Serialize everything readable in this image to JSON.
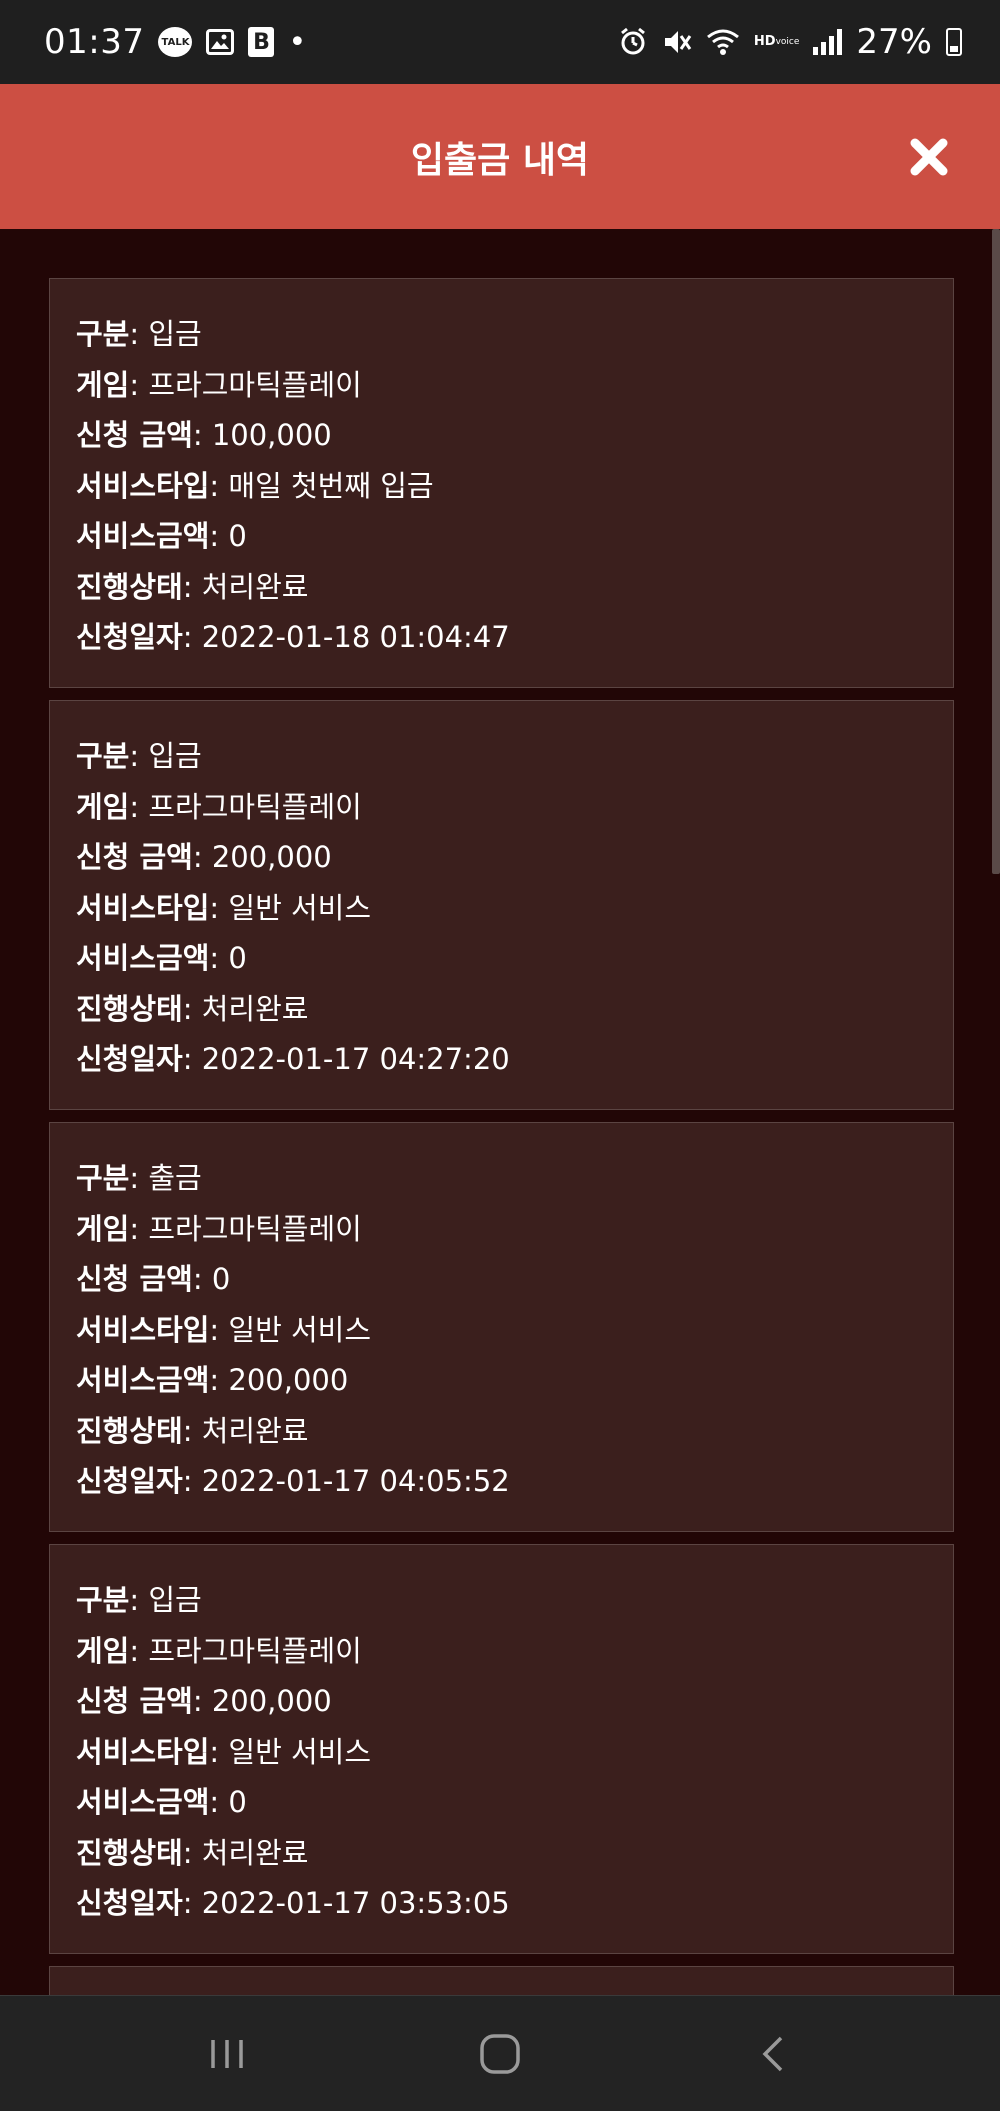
{
  "status_bar": {
    "time": "01:37",
    "talk_label": "TALK",
    "battery": "27%",
    "hd_label": "HD",
    "hd_sub": "voice"
  },
  "header": {
    "title": "입출금 내역"
  },
  "labels": {
    "type": "구분",
    "game": "게임",
    "amount": "신청 금액",
    "service_type": "서비스타입",
    "service_amount": "서비스금액",
    "status": "진행상태",
    "date": "신청일자"
  },
  "transactions": [
    {
      "type": "입금",
      "game": "프라그마틱플레이",
      "amount": "100,000",
      "service_type": "매일 첫번째 입금",
      "service_amount": "0",
      "status": "처리완료",
      "date": "2022-01-18 01:04:47"
    },
    {
      "type": "입금",
      "game": "프라그마틱플레이",
      "amount": "200,000",
      "service_type": "일반 서비스",
      "service_amount": "0",
      "status": "처리완료",
      "date": "2022-01-17 04:27:20"
    },
    {
      "type": "출금",
      "game": "프라그마틱플레이",
      "amount": "0",
      "service_type": "일반 서비스",
      "service_amount": "200,000",
      "status": "처리완료",
      "date": "2022-01-17 04:05:52"
    },
    {
      "type": "입금",
      "game": "프라그마틱플레이",
      "amount": "200,000",
      "service_type": "일반 서비스",
      "service_amount": "0",
      "status": "처리완료",
      "date": "2022-01-17 03:53:05"
    }
  ],
  "colors": {
    "header_bg": "#cc4f43",
    "page_bg": "#220606",
    "card_bg": "#3b1f1d"
  }
}
